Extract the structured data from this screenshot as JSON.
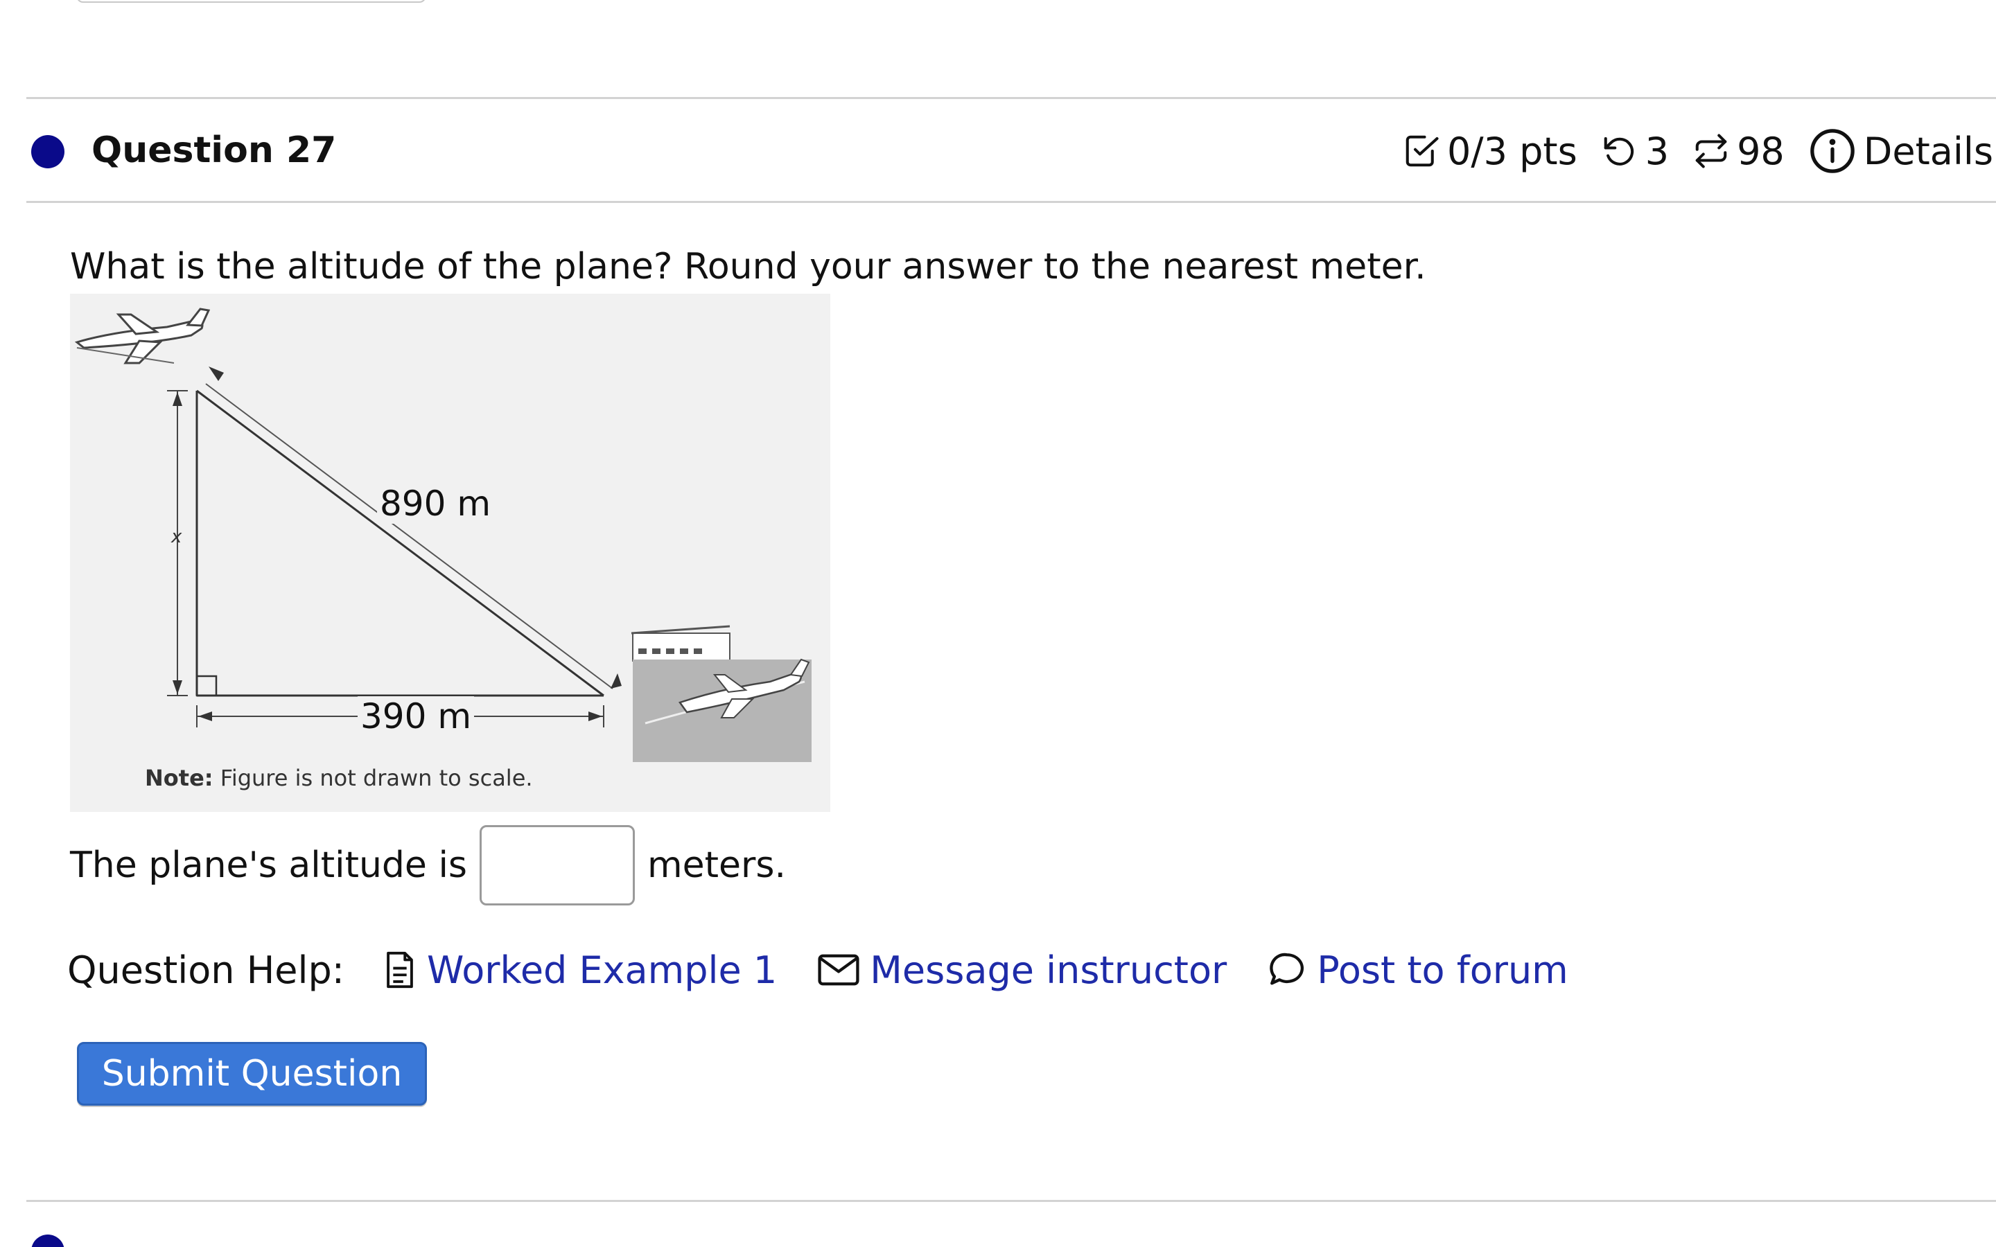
{
  "question": {
    "title": "Question 27",
    "score": "0/3 pts",
    "attempts": "3",
    "versions": "98",
    "details_label": "Details",
    "prompt": "What is the altitude of the plane? Round your answer to the nearest meter."
  },
  "figure": {
    "hypotenuse_label": "890 m",
    "base_label": "390 m",
    "height_label": "x",
    "note_bold": "Note:",
    "note_text": " Figure is not drawn to scale."
  },
  "answer": {
    "prefix": "The plane's altitude is",
    "suffix": "meters.",
    "value": ""
  },
  "help": {
    "label": "Question Help:",
    "worked_example": "Worked Example 1",
    "message": "Message instructor",
    "forum": "Post to forum"
  },
  "submit_label": "Submit Question",
  "colors": {
    "question_dot": "#0a0a8a",
    "link": "#1e2ba8",
    "submit_bg": "#3a78d8"
  }
}
